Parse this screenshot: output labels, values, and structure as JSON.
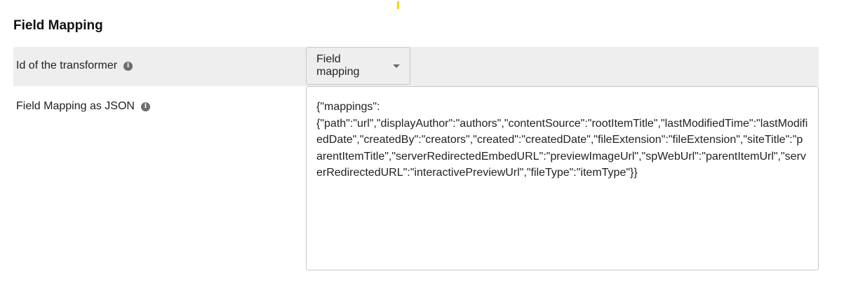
{
  "section": {
    "title": "Field Mapping"
  },
  "transformer": {
    "label": "Id of the transformer",
    "info_glyph": "i",
    "selected_value": "Field mapping"
  },
  "mapping": {
    "label": "Field Mapping as JSON",
    "info_glyph": "i",
    "json_value": "{\"mappings\":\n{\"path\":\"url\",\"displayAuthor\":\"authors\",\"contentSource\":\"rootItemTitle\",\"lastModifiedTime\":\"lastModifiedDate\",\"createdBy\":\"creators\",\"created\":\"createdDate\",\"fileExtension\":\"fileExtension\",\"siteTitle\":\"parentItemTitle\",\"serverRedirectedEmbedURL\":\"previewImageUrl\",\"spWebUrl\":\"parentItemUrl\",\"serverRedirectedURL\":\"interactivePreviewUrl\",\"fileType\":\"itemType\"}}"
  },
  "icons": {
    "info": "info-icon",
    "dropdown": "chevron-down-icon"
  },
  "colors": {
    "row_shade": "#eeeeee",
    "border": "#c8c8c8",
    "accent": "#f2d600"
  }
}
